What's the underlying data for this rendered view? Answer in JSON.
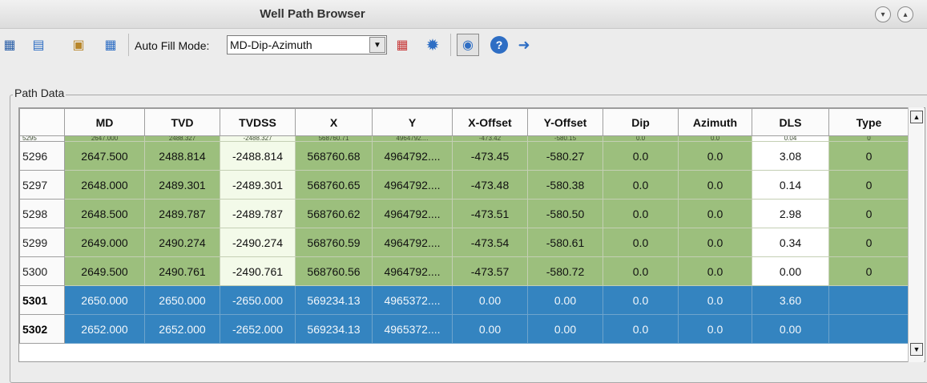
{
  "window": {
    "title": "Well Path Browser"
  },
  "toolbar": {
    "auto_fill_label": "Auto Fill Mode:",
    "auto_fill_value": "MD-Dip-Azimuth",
    "dropdown_arrow": "▼"
  },
  "panel": {
    "label": "Path Data"
  },
  "table": {
    "columns": [
      "MD",
      "TVD",
      "TVDSS",
      "X",
      "Y",
      "X-Offset",
      "Y-Offset",
      "Dip",
      "Azimuth",
      "DLS",
      "Type"
    ],
    "partial_row": {
      "index": "5295",
      "cells": [
        "2647.000",
        "2488.327",
        "-2488.327",
        "568760.71",
        "4964792....",
        "-473.42",
        "-580.15",
        "0.0",
        "0.0",
        "0.04",
        "0"
      ]
    },
    "rows": [
      {
        "index": "5296",
        "cells": [
          "2647.500",
          "2488.814",
          "-2488.814",
          "568760.68",
          "4964792....",
          "-473.45",
          "-580.27",
          "0.0",
          "0.0",
          "3.08",
          "0"
        ],
        "selected": false
      },
      {
        "index": "5297",
        "cells": [
          "2648.000",
          "2489.301",
          "-2489.301",
          "568760.65",
          "4964792....",
          "-473.48",
          "-580.38",
          "0.0",
          "0.0",
          "0.14",
          "0"
        ],
        "selected": false
      },
      {
        "index": "5298",
        "cells": [
          "2648.500",
          "2489.787",
          "-2489.787",
          "568760.62",
          "4964792....",
          "-473.51",
          "-580.50",
          "0.0",
          "0.0",
          "2.98",
          "0"
        ],
        "selected": false
      },
      {
        "index": "5299",
        "cells": [
          "2649.000",
          "2490.274",
          "-2490.274",
          "568760.59",
          "4964792....",
          "-473.54",
          "-580.61",
          "0.0",
          "0.0",
          "0.34",
          "0"
        ],
        "selected": false
      },
      {
        "index": "5300",
        "cells": [
          "2649.500",
          "2490.761",
          "-2490.761",
          "568760.56",
          "4964792....",
          "-473.57",
          "-580.72",
          "0.0",
          "0.0",
          "0.00",
          "0"
        ],
        "selected": false
      },
      {
        "index": "5301",
        "cells": [
          "2650.000",
          "2650.000",
          "-2650.000",
          "569234.13",
          "4965372....",
          "0.00",
          "0.00",
          "0.0",
          "0.0",
          "3.60",
          ""
        ],
        "selected": true
      },
      {
        "index": "5302",
        "cells": [
          "2652.000",
          "2652.000",
          "-2652.000",
          "569234.13",
          "4965372....",
          "0.00",
          "0.00",
          "0.0",
          "0.0",
          "0.00",
          ""
        ],
        "selected": true
      }
    ]
  },
  "icons": {
    "window_buttons": [
      "chevron-down-icon",
      "chevron-up-icon"
    ],
    "toolbar": [
      "table-export-icon",
      "document-icon",
      "paste-icon",
      "grid-edit-icon",
      "table-settings-icon",
      "gear-icon",
      "target-icon",
      "help-icon",
      "exit-icon"
    ]
  },
  "colors": {
    "row_green": "#9cbf7d",
    "row_light": "#f3fae9",
    "selection_blue": "#3484c0"
  }
}
